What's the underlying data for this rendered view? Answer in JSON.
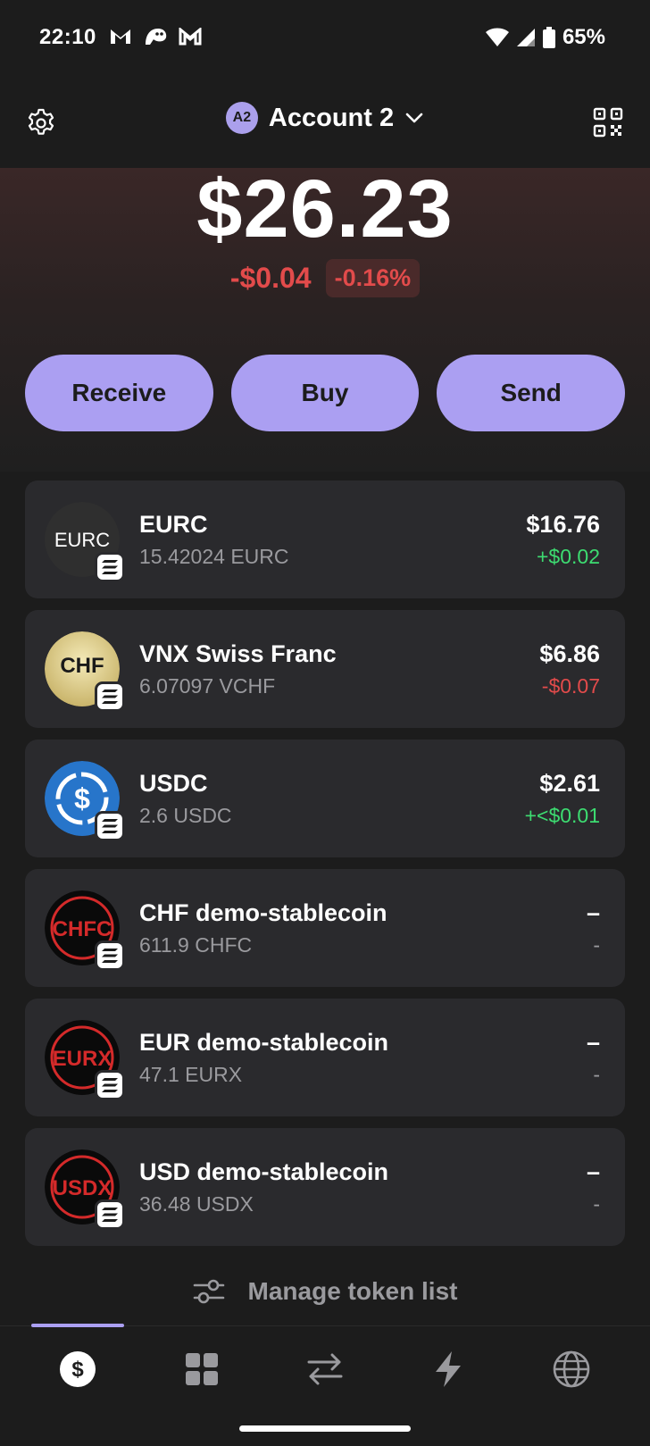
{
  "status_bar": {
    "time": "22:10",
    "battery": "65%",
    "icons": [
      "gmail-icon",
      "ghost-icon",
      "gmail-icon",
      "wifi-icon",
      "signal-icon",
      "battery-icon"
    ]
  },
  "header": {
    "avatar_initials": "A2",
    "account_name": "Account 2",
    "settings_icon": "gear-icon",
    "qr_icon": "qr-code-icon"
  },
  "balance": {
    "total": "$26.23",
    "change_amount": "-$0.04",
    "change_percent": "-0.16%"
  },
  "actions": {
    "receive": "Receive",
    "buy": "Buy",
    "send": "Send"
  },
  "tokens": [
    {
      "name": "EURC",
      "amount": "15.42024 EURC",
      "value": "$16.76",
      "change": "+$0.02",
      "change_type": "pos",
      "icon_text": "EURC"
    },
    {
      "name": "VNX Swiss Franc",
      "amount": "6.07097 VCHF",
      "value": "$6.86",
      "change": "-$0.07",
      "change_type": "neg",
      "icon_text": "CHF"
    },
    {
      "name": "USDC",
      "amount": "2.6 USDC",
      "value": "$2.61",
      "change": "+<$0.01",
      "change_type": "pos",
      "icon_text": "$"
    },
    {
      "name": "CHF demo-stablecoin",
      "amount": "611.9 CHFC",
      "value": "–",
      "change": "-",
      "change_type": "neutral",
      "icon_text": "CHFC"
    },
    {
      "name": "EUR demo-stablecoin",
      "amount": "47.1 EURX",
      "value": "–",
      "change": "-",
      "change_type": "neutral",
      "icon_text": "EURX"
    },
    {
      "name": "USD demo-stablecoin",
      "amount": "36.48 USDX",
      "value": "–",
      "change": "-",
      "change_type": "neutral",
      "icon_text": "USDX"
    }
  ],
  "manage": {
    "label": "Manage token list"
  },
  "colors": {
    "accent": "#ab9ff2",
    "negative": "#e24b4b",
    "positive": "#3ddc71",
    "card": "#2a2a2d"
  }
}
